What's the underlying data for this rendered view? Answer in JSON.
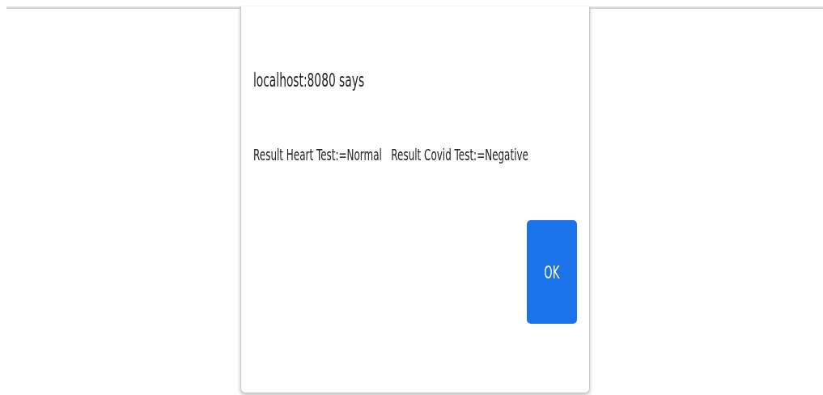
{
  "dialog": {
    "title": "localhost:8080 says",
    "message": "Result Heart Test:=Normal   Result Covid Test:=Negative",
    "buttons": [
      "OK"
    ]
  }
}
